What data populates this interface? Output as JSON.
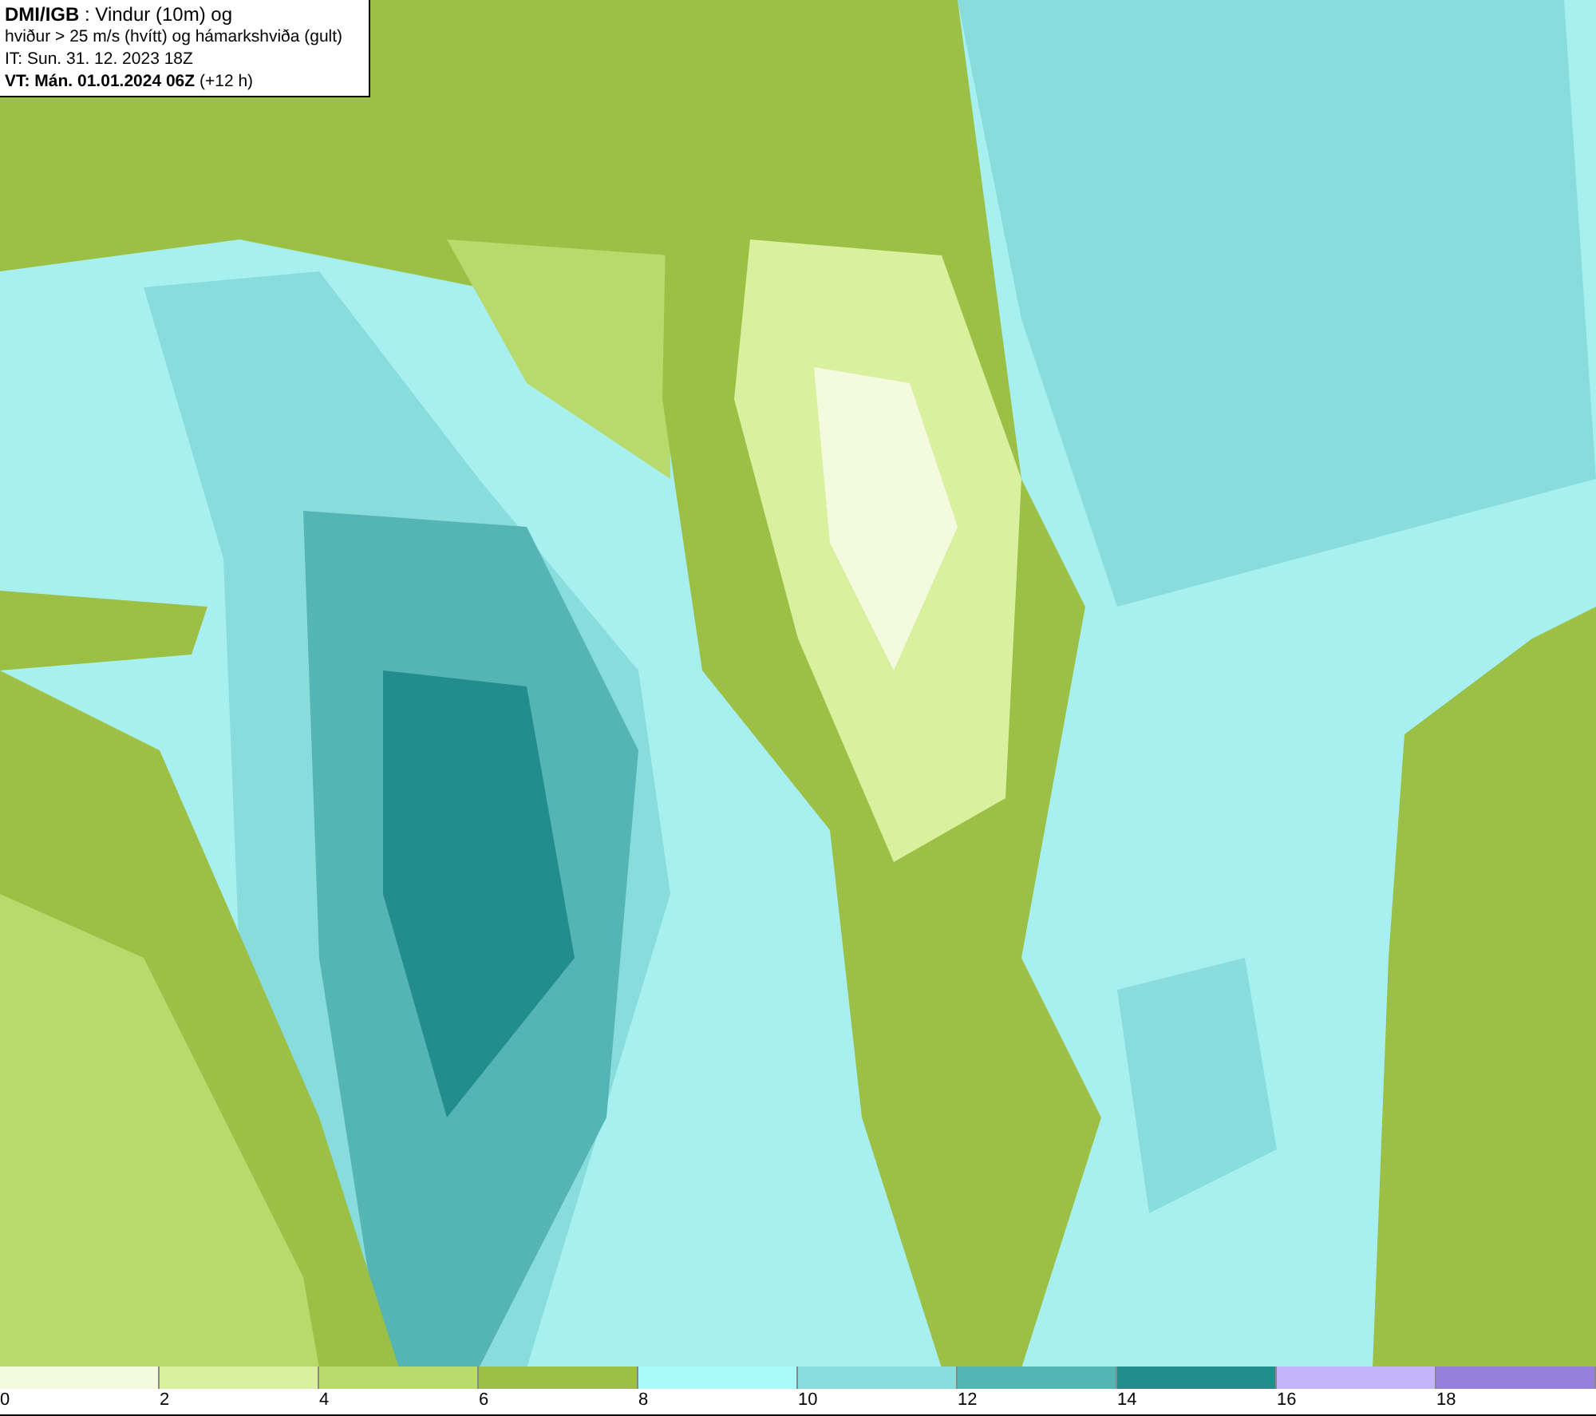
{
  "header": {
    "lines": [
      "**DMI/IGB** : Vindur (10m) og",
      "hviður > 25 m/s (hvítt) og hámarkshviða (gult)",
      "IT: Sun. 31. 12. 2023 18Z",
      "**VT: Mán. 01.01.2024 06Z** (+12 h)"
    ]
  },
  "legend": [
    {
      "label": "0",
      "color": "#f4fade"
    },
    {
      "label": "2",
      "color": "#d9f09e"
    },
    {
      "label": "4",
      "color": "#b8d96c"
    },
    {
      "label": "6",
      "color": "#9cc046"
    },
    {
      "label": "8",
      "color": "#aafafa"
    },
    {
      "label": "10",
      "color": "#88dcdc"
    },
    {
      "label": "12",
      "color": "#55b4b4"
    },
    {
      "label": "14",
      "color": "#238c8c"
    },
    {
      "label": "16",
      "color": "#c4b4fa"
    },
    {
      "label": "18",
      "color": "#9680dc"
    }
  ]
}
